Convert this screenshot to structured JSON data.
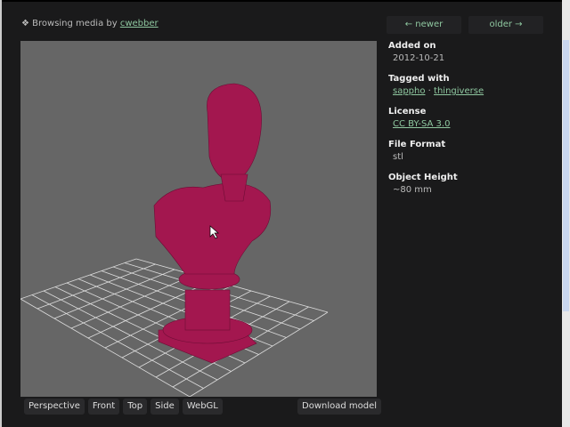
{
  "header": {
    "prefix": "❖ Browsing media by",
    "user": "cwebber"
  },
  "nav": {
    "newer": "← newer",
    "older": "older →"
  },
  "meta": [
    {
      "label": "Added on",
      "value": "2012-10-21"
    },
    {
      "label": "Tagged with",
      "tags": [
        "sappho",
        "thingiverse"
      ],
      "sep": " · "
    },
    {
      "label": "License",
      "link": "CC BY-SA 3.0"
    },
    {
      "label": "File Format",
      "value": "stl"
    },
    {
      "label": "Object Height",
      "value": "~80 mm"
    }
  ],
  "views": [
    "Perspective",
    "Front",
    "Top",
    "Side",
    "WebGL"
  ],
  "download": "Download model",
  "colors": {
    "model": "#a3174f",
    "viewer_bg": "#666666",
    "link": "#8fc8a0"
  }
}
